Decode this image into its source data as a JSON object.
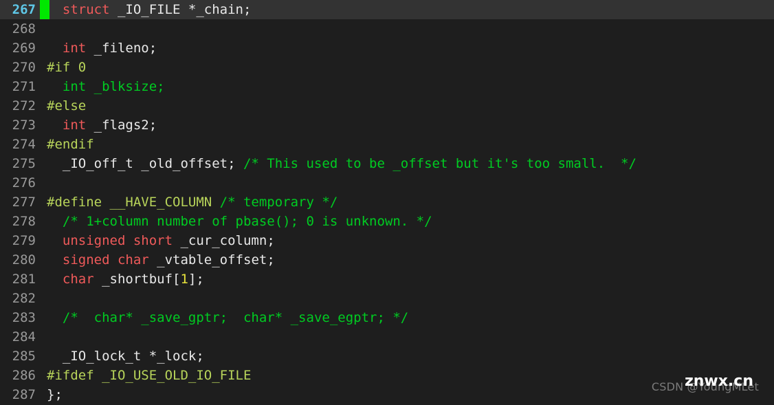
{
  "editor": {
    "first_line_number": 267,
    "last_line_number": 287,
    "current_line_number": 267,
    "colors": {
      "background": "#1e1e1e",
      "current_line_background": "#333333",
      "gutter_text": "#9a9a9a",
      "current_gutter_text": "#5fc8e8",
      "cursor": "#00e800",
      "keyword": "#f05a5a",
      "identifier": "#e8e8e8",
      "comment": "#00cc22",
      "preprocessor": "#b8d45a",
      "number": "#e8e33c",
      "inactive_code": "#00cc22"
    },
    "lines": [
      {
        "number": "267",
        "current": true,
        "tokens": [
          {
            "text": "  ",
            "type": "punc"
          },
          {
            "text": "struct",
            "type": "kw"
          },
          {
            "text": " _IO_FILE *_chain;",
            "type": "id"
          }
        ]
      },
      {
        "number": "268",
        "current": false,
        "tokens": []
      },
      {
        "number": "269",
        "current": false,
        "tokens": [
          {
            "text": "  ",
            "type": "punc"
          },
          {
            "text": "int",
            "type": "kw"
          },
          {
            "text": " _fileno;",
            "type": "id"
          }
        ]
      },
      {
        "number": "270",
        "current": false,
        "tokens": [
          {
            "text": "#if 0",
            "type": "pre"
          }
        ]
      },
      {
        "number": "271",
        "current": false,
        "tokens": [
          {
            "text": "  int _blksize;",
            "type": "inactive"
          }
        ]
      },
      {
        "number": "272",
        "current": false,
        "tokens": [
          {
            "text": "#else",
            "type": "pre"
          }
        ]
      },
      {
        "number": "273",
        "current": false,
        "tokens": [
          {
            "text": "  ",
            "type": "punc"
          },
          {
            "text": "int",
            "type": "kw"
          },
          {
            "text": " _flags2;",
            "type": "id"
          }
        ]
      },
      {
        "number": "274",
        "current": false,
        "tokens": [
          {
            "text": "#endif",
            "type": "pre"
          }
        ]
      },
      {
        "number": "275",
        "current": false,
        "tokens": [
          {
            "text": "  _IO_off_t _old_offset; ",
            "type": "id"
          },
          {
            "text": "/* This used to be _offset but it's too small.  */",
            "type": "comment"
          }
        ]
      },
      {
        "number": "276",
        "current": false,
        "tokens": []
      },
      {
        "number": "277",
        "current": false,
        "tokens": [
          {
            "text": "#define __HAVE_COLUMN ",
            "type": "pre"
          },
          {
            "text": "/* temporary */",
            "type": "comment"
          }
        ]
      },
      {
        "number": "278",
        "current": false,
        "tokens": [
          {
            "text": "  ",
            "type": "punc"
          },
          {
            "text": "/* 1+column number of pbase(); 0 is unknown. */",
            "type": "comment"
          }
        ]
      },
      {
        "number": "279",
        "current": false,
        "tokens": [
          {
            "text": "  ",
            "type": "punc"
          },
          {
            "text": "unsigned short",
            "type": "kw"
          },
          {
            "text": " _cur_column;",
            "type": "id"
          }
        ]
      },
      {
        "number": "280",
        "current": false,
        "tokens": [
          {
            "text": "  ",
            "type": "punc"
          },
          {
            "text": "signed char",
            "type": "kw"
          },
          {
            "text": " _vtable_offset;",
            "type": "id"
          }
        ]
      },
      {
        "number": "281",
        "current": false,
        "tokens": [
          {
            "text": "  ",
            "type": "punc"
          },
          {
            "text": "char",
            "type": "kw"
          },
          {
            "text": " _shortbuf[",
            "type": "id"
          },
          {
            "text": "1",
            "type": "num"
          },
          {
            "text": "];",
            "type": "id"
          }
        ]
      },
      {
        "number": "282",
        "current": false,
        "tokens": []
      },
      {
        "number": "283",
        "current": false,
        "tokens": [
          {
            "text": "  ",
            "type": "punc"
          },
          {
            "text": "/*  char* _save_gptr;  char* _save_egptr; */",
            "type": "comment"
          }
        ]
      },
      {
        "number": "284",
        "current": false,
        "tokens": []
      },
      {
        "number": "285",
        "current": false,
        "tokens": [
          {
            "text": "  _IO_lock_t *_lock;",
            "type": "id"
          }
        ]
      },
      {
        "number": "286",
        "current": false,
        "tokens": [
          {
            "text": "#ifdef _IO_USE_OLD_IO_FILE",
            "type": "pre"
          }
        ]
      },
      {
        "number": "287",
        "current": false,
        "tokens": [
          {
            "text": "};",
            "type": "id"
          }
        ]
      }
    ]
  },
  "watermarks": {
    "csdn": "CSDN @YoungMLet",
    "znwx": "znwx.cn"
  }
}
